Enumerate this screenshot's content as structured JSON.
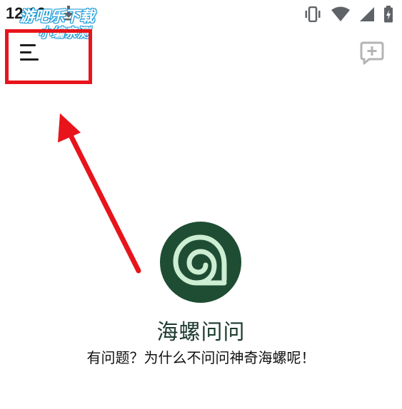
{
  "status_bar": {
    "time": "12:19",
    "icons": [
      "download-icon",
      "vibrate-icon",
      "wifi-icon",
      "signal-icon",
      "battery-icon"
    ]
  },
  "watermark": {
    "line1": "游吧乐下载",
    "line2": "小编亲测"
  },
  "toolbar": {
    "menu_icon": "hamburger-menu-icon",
    "new_chat_icon": "new-chat-icon"
  },
  "main": {
    "app_name": "海螺问问",
    "tagline": "有问题？为什么不问问神奇海螺呢！"
  },
  "colors": {
    "logo_background": "#1e4d33",
    "logo_foreground": "#cdeed2",
    "annotation_red": "#e8141b",
    "watermark_blue": "#1a9bd8"
  }
}
